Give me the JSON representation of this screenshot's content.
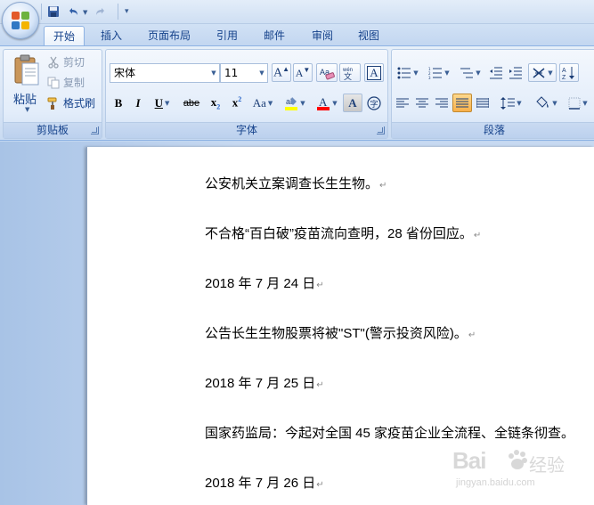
{
  "ribbon_tabs": [
    {
      "label": "开始",
      "active": true
    },
    {
      "label": "插入"
    },
    {
      "label": "页面布局"
    },
    {
      "label": "引用"
    },
    {
      "label": "邮件"
    },
    {
      "label": "审阅"
    },
    {
      "label": "视图"
    }
  ],
  "clipboard": {
    "paste_label": "粘贴",
    "cut_label": "剪切",
    "copy_label": "复制",
    "format_painter_label": "格式刷",
    "group_label": "剪贴板"
  },
  "font": {
    "font_name": "宋体",
    "font_size": "11",
    "bold": "B",
    "italic": "I",
    "underline": "U",
    "strikethrough": "abe",
    "subscript_base": "x",
    "subscript": "2",
    "superscript_base": "x",
    "superscript": "2",
    "change_case": "Aa",
    "char_border": "A",
    "char_shading": "A",
    "group_label": "字体"
  },
  "paragraph": {
    "group_label": "段落"
  },
  "document": {
    "paragraphs": [
      "公安机关立案调查长生生物。",
      "不合格“百白破”疫苗流向查明，28 省份回应。",
      "2018 年 7 月 24 日",
      "公告长生生物股票将被\"ST\"(警示投资风险)。",
      "2018 年 7 月 25 日",
      "国家药监局：今起对全国 45 家疫苗企业全流程、全链条彻查。",
      "2018 年 7 月 26 日"
    ],
    "paragraph_mark": "↵"
  },
  "watermark": {
    "brand": "Bai",
    "brand_suffix": "经验",
    "url": "jingyan.baidu.com"
  },
  "colors": {
    "ribbon_text": "#15428b",
    "highlight": "#ffff00",
    "font_color": "#ff0000",
    "selected_button": "#f8b04a"
  }
}
